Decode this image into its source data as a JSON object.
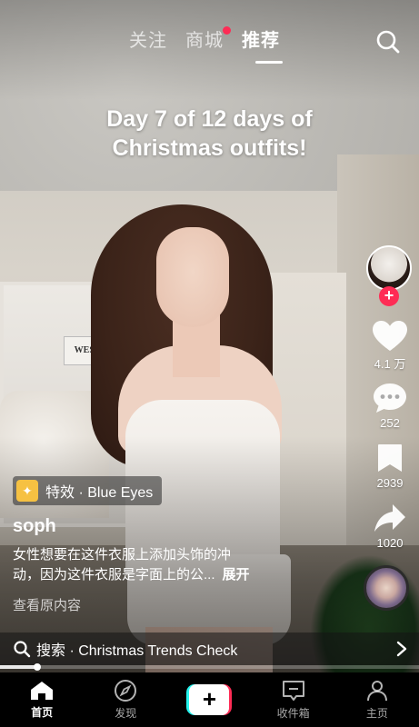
{
  "topnav": {
    "tabs": [
      {
        "label": "关注"
      },
      {
        "label": "商城",
        "has_dot": true
      },
      {
        "label": "推荐",
        "active": true
      }
    ]
  },
  "video": {
    "overlay_text_line1": "Day 7 of 12 days of",
    "overlay_text_line2": "Christmas outfits!",
    "mirror_sign": "WESTWO"
  },
  "rail": {
    "likes": "4.1 万",
    "comments": "252",
    "favorites": "2939",
    "shares": "1020"
  },
  "info": {
    "effect_label": "特效 · Blue Eyes",
    "username": "soph",
    "description_line1": "女性想要在这件衣服上添加头饰的冲",
    "description_line2": "动，因为这件衣服是字面上的公...",
    "expand_label": "展开",
    "view_original": "查看原内容"
  },
  "search_bar": {
    "text": "搜索 · Christmas Trends Check"
  },
  "playback": {
    "progress_fraction": 0.09
  },
  "tabbar": {
    "items": [
      {
        "label": "首页",
        "icon": "home-icon",
        "active": true
      },
      {
        "label": "发现",
        "icon": "compass-icon"
      },
      {
        "label": "",
        "icon": "create-plus-icon"
      },
      {
        "label": "收件箱",
        "icon": "inbox-icon"
      },
      {
        "label": "主页",
        "icon": "profile-icon"
      }
    ]
  },
  "colors": {
    "accent_red": "#fe2c55",
    "accent_cyan": "#25f4ee",
    "effect_yellow": "#f6c142"
  }
}
